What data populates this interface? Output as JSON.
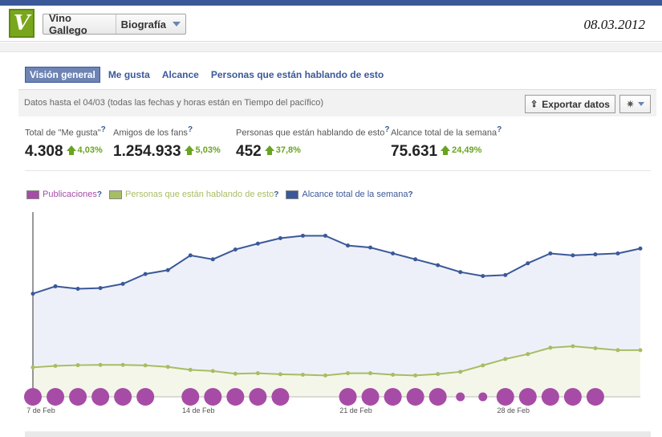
{
  "header": {
    "logo_letter": "V",
    "page_name": "Vino Gallego",
    "section": "Biografía",
    "date": "08.03.2012"
  },
  "tabs": [
    {
      "label": "Visión general",
      "active": true
    },
    {
      "label": "Me gusta",
      "active": false
    },
    {
      "label": "Alcance",
      "active": false
    },
    {
      "label": "Personas que están hablando de esto",
      "active": false
    }
  ],
  "infobar": {
    "note": "Datos hasta el 04/03 (todas las fechas y horas están en Tiempo del pacífico)",
    "export_label": "Exportar datos",
    "export_icon": "upload-icon",
    "settings_icon": "gear-icon"
  },
  "stats": [
    {
      "label": "Total de \"Me gusta\"",
      "value": "4.308",
      "change": "4,03%"
    },
    {
      "label": "Amigos de los fans",
      "value": "1.254.933",
      "change": "5,03%"
    },
    {
      "label": "Personas que están hablando de esto",
      "value": "452",
      "change": "37,8%"
    },
    {
      "label": "Alcance total de la semana",
      "value": "75.631",
      "change": "24,49%"
    }
  ],
  "help_mark": "?",
  "colors": {
    "posts": "#a64ca6",
    "talking": "#a7bd64",
    "reach": "#3b5998",
    "increase": "#6aa320"
  },
  "chart_data": {
    "type": "line",
    "legend": [
      {
        "name": "Publicaciones",
        "color": "#a64ca6"
      },
      {
        "name": "Personas que están hablando de esto",
        "color": "#a7bd64"
      },
      {
        "name": "Alcance total de la semana",
        "color": "#3b5998"
      }
    ],
    "x_ticks": [
      "7 de Feb",
      "14 de Feb",
      "21 de Feb",
      "28 de Feb"
    ],
    "series": [
      {
        "name": "Alcance total de la semana",
        "values": [
          42000,
          45000,
          44000,
          44300,
          46000,
          50000,
          51600,
          57600,
          56000,
          60000,
          62400,
          64600,
          65600,
          65600,
          61600,
          60800,
          58400,
          56000,
          53600,
          50800,
          49200,
          49600,
          54400,
          58400,
          57600,
          58000,
          58400,
          60400
        ]
      },
      {
        "name": "Personas que están hablando de esto",
        "values": [
          12000,
          12600,
          12900,
          13000,
          13000,
          12800,
          12200,
          11000,
          10500,
          9400,
          9600,
          9200,
          9000,
          8700,
          9600,
          9600,
          9000,
          8700,
          9300,
          10200,
          12800,
          15400,
          17400,
          20000,
          20600,
          19800,
          19000,
          19000
        ]
      },
      {
        "name": "Publicaciones",
        "sizes": [
          1,
          1,
          1,
          1,
          1,
          1,
          0,
          1,
          1,
          1,
          1,
          1,
          0,
          0,
          1,
          1,
          1,
          1,
          1,
          0.5,
          0.5,
          1,
          1,
          1,
          1,
          1,
          0,
          0
        ]
      }
    ],
    "grid": false
  }
}
